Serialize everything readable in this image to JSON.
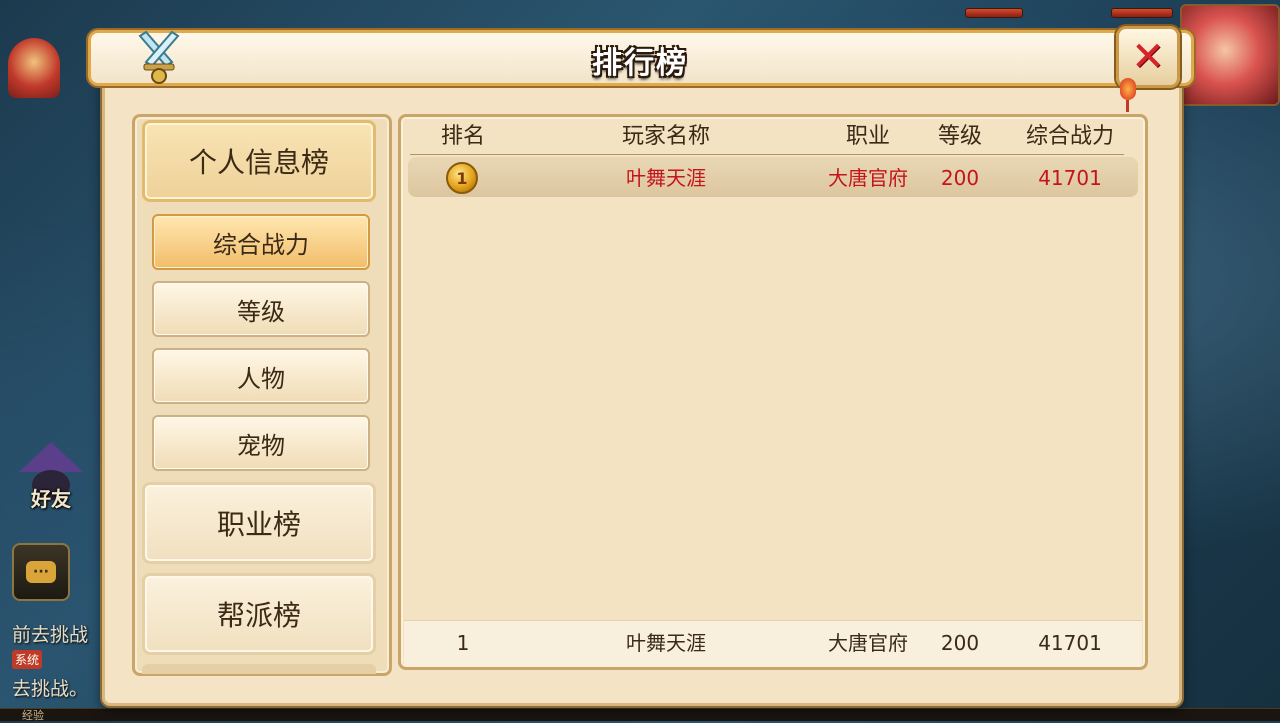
{
  "window": {
    "title": "排行榜"
  },
  "hud": {
    "friend_label": "好友",
    "chat_icon": "chat-bubble-icon",
    "msg_line1": "前去挑战",
    "msg_tag": "系统",
    "msg_line2": "去挑战。",
    "exp_label": "经验"
  },
  "nav": {
    "categories": [
      {
        "label": "个人信息榜",
        "active": true
      },
      {
        "label": "职业榜",
        "active": false
      },
      {
        "label": "帮派榜",
        "active": false
      }
    ],
    "subtabs": [
      {
        "label": "综合战力",
        "active": true
      },
      {
        "label": "等级",
        "active": false
      },
      {
        "label": "人物",
        "active": false
      },
      {
        "label": "宠物",
        "active": false
      }
    ]
  },
  "table": {
    "headers": [
      "排名",
      "玩家名称",
      "职业",
      "等级",
      "综合战力"
    ],
    "rows": [
      {
        "rank_icon": "gold-medal-icon",
        "name": "叶舞天涯",
        "job": "大唐官府",
        "level": "200",
        "power": "41701"
      }
    ],
    "footer": {
      "rank": "1",
      "name": "叶舞天涯",
      "job": "大唐官府",
      "level": "200",
      "power": "41701"
    }
  },
  "colors": {
    "highlight_text": "#c4141c",
    "close_x": "#d8232a",
    "panel_bg": "#f4e3c4"
  }
}
